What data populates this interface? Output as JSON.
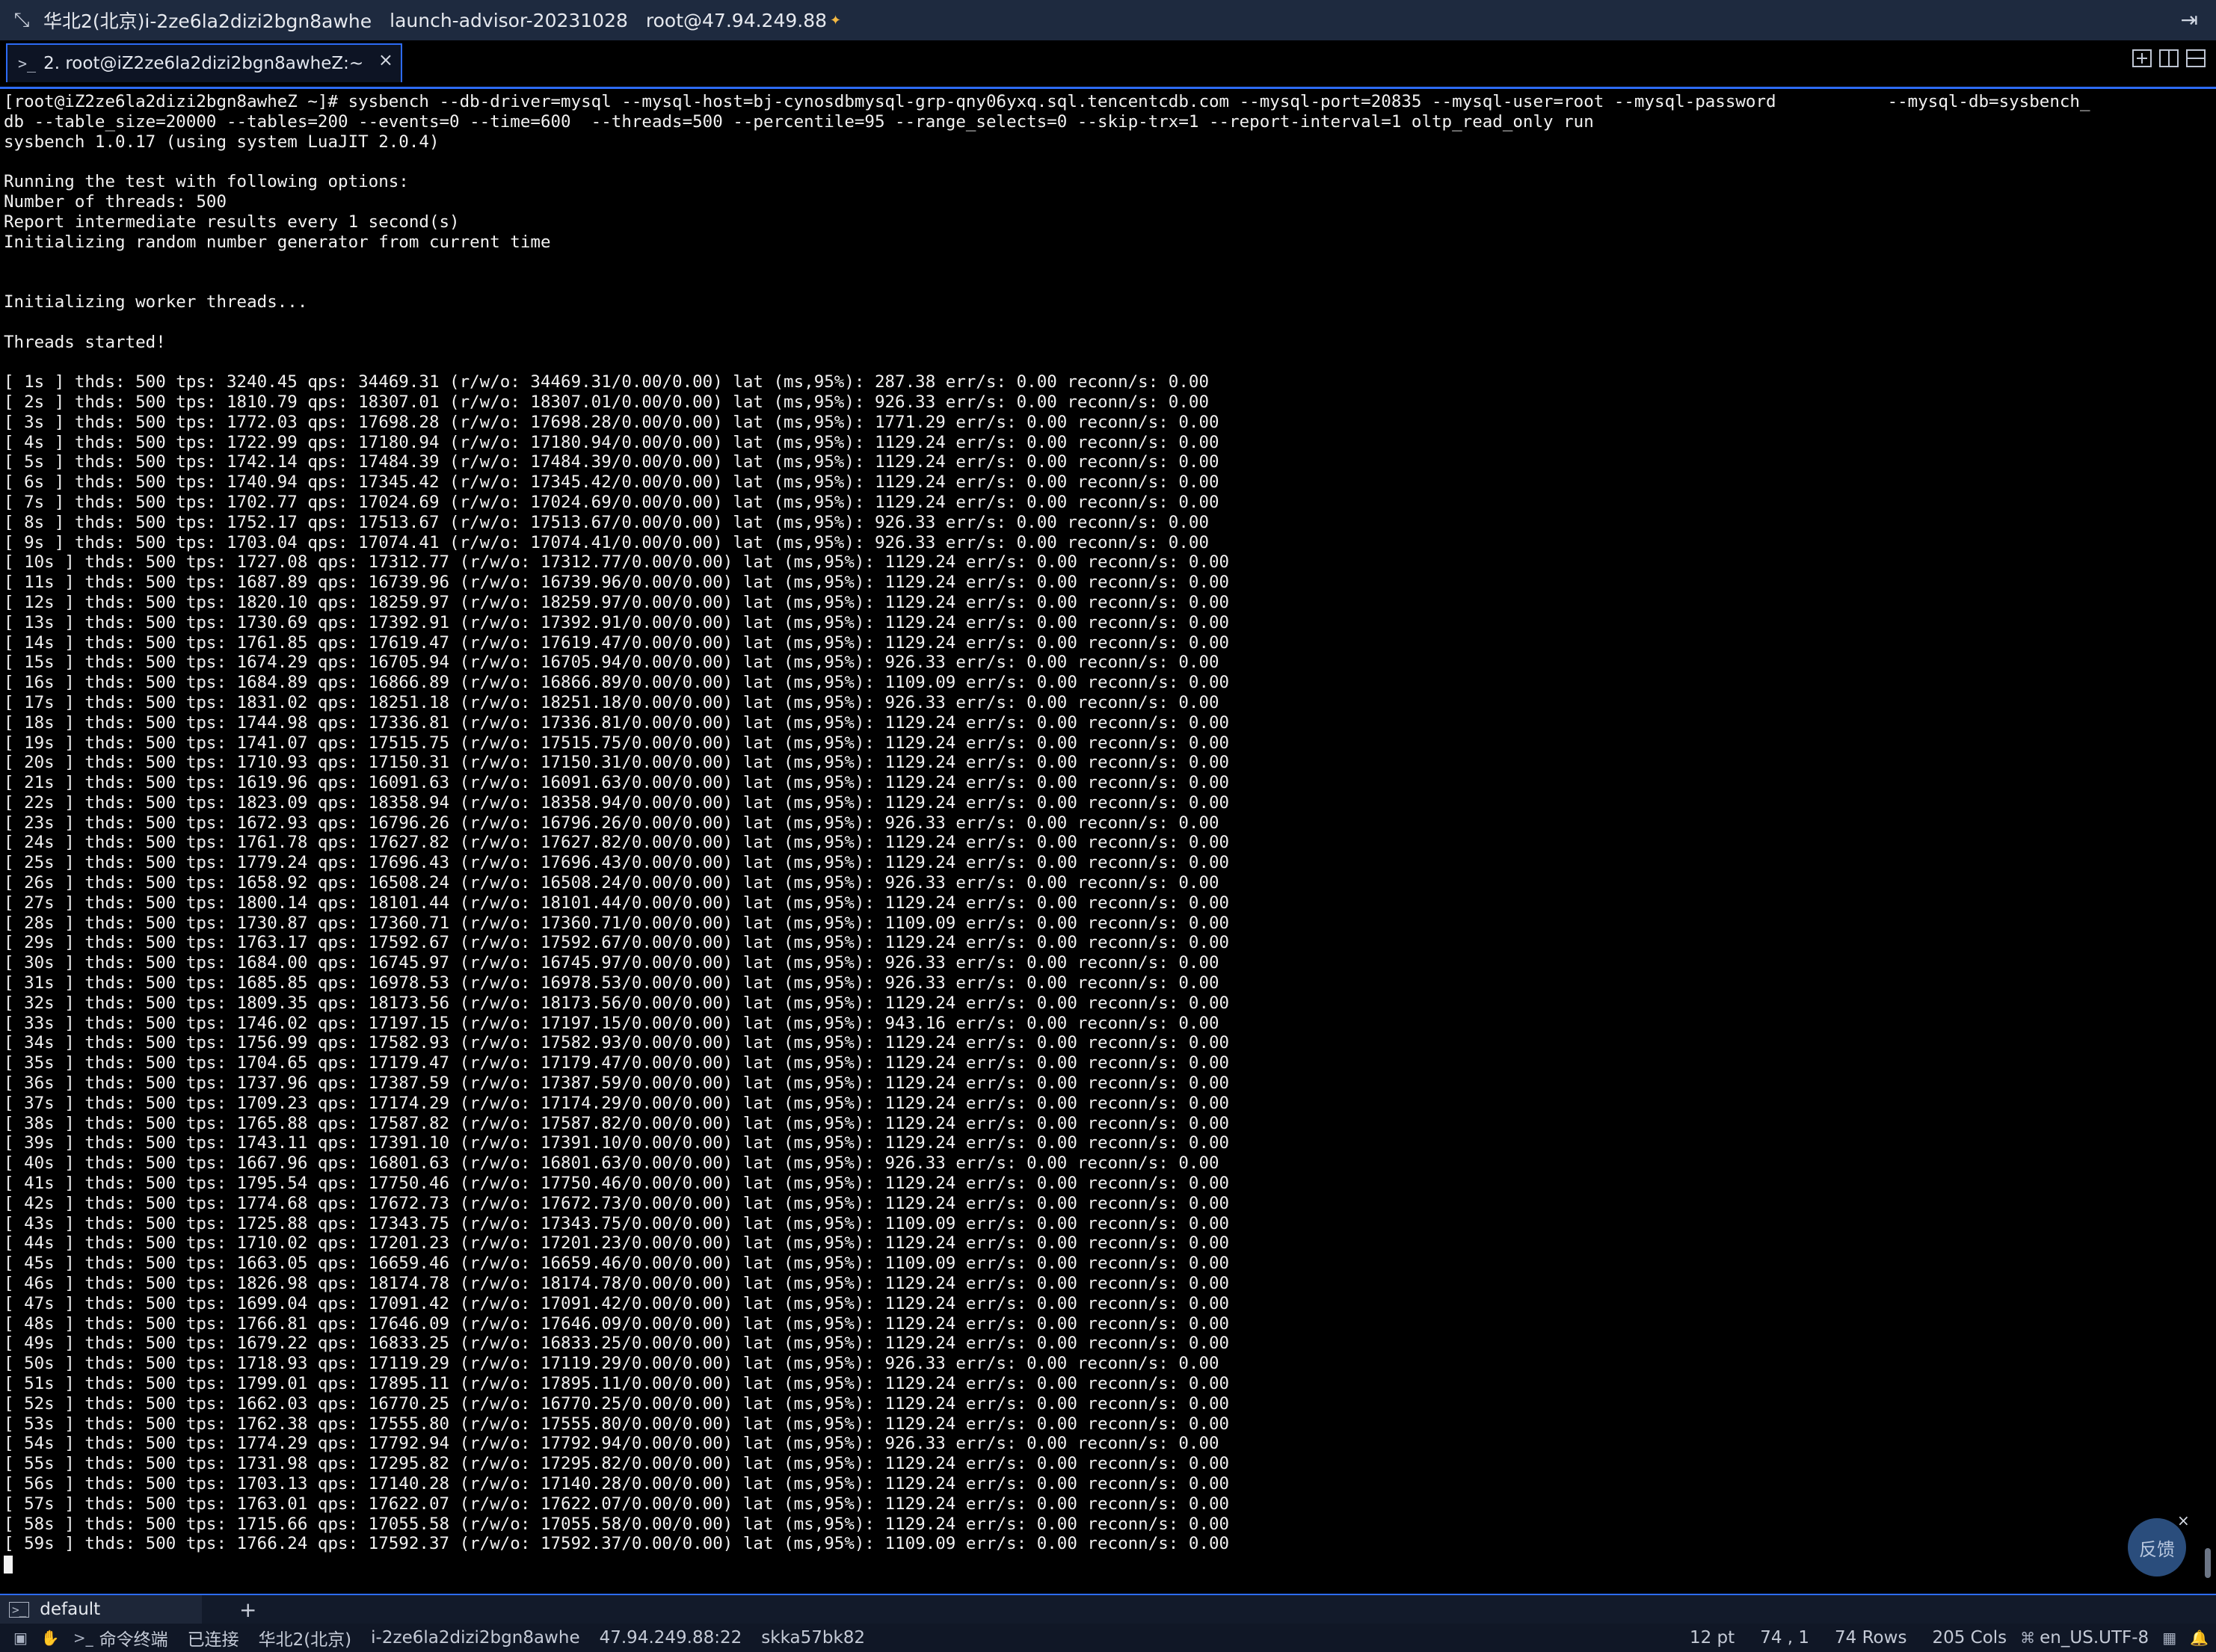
{
  "titlebar": {
    "region_host": "华北2(北京)i-2ze6la2dizi2bgn8awhe",
    "project": "launch-advisor-20231028",
    "user_host": "root@47.94.249.88"
  },
  "tab": {
    "label": "2. root@iZ2ze6la2dizi2bgn8awheZ:~",
    "close_glyph": "×"
  },
  "terminal": {
    "lines": [
      "[root@iZ2ze6la2dizi2bgn8awheZ ~]# sysbench --db-driver=mysql --mysql-host=bj-cynosdbmysql-grp-qny06yxq.sql.tencentcdb.com --mysql-port=20835 --mysql-user=root --mysql-password           --mysql-db=sysbench_",
      "db --table_size=20000 --tables=200 --events=0 --time=600  --threads=500 --percentile=95 --range_selects=0 --skip-trx=1 --report-interval=1 oltp_read_only run",
      "sysbench 1.0.17 (using system LuaJIT 2.0.4)",
      "",
      "Running the test with following options:",
      "Number of threads: 500",
      "Report intermediate results every 1 second(s)",
      "Initializing random number generator from current time",
      "",
      "",
      "Initializing worker threads...",
      "",
      "Threads started!",
      "",
      "[ 1s ] thds: 500 tps: 3240.45 qps: 34469.31 (r/w/o: 34469.31/0.00/0.00) lat (ms,95%): 287.38 err/s: 0.00 reconn/s: 0.00",
      "[ 2s ] thds: 500 tps: 1810.79 qps: 18307.01 (r/w/o: 18307.01/0.00/0.00) lat (ms,95%): 926.33 err/s: 0.00 reconn/s: 0.00",
      "[ 3s ] thds: 500 tps: 1772.03 qps: 17698.28 (r/w/o: 17698.28/0.00/0.00) lat (ms,95%): 1771.29 err/s: 0.00 reconn/s: 0.00",
      "[ 4s ] thds: 500 tps: 1722.99 qps: 17180.94 (r/w/o: 17180.94/0.00/0.00) lat (ms,95%): 1129.24 err/s: 0.00 reconn/s: 0.00",
      "[ 5s ] thds: 500 tps: 1742.14 qps: 17484.39 (r/w/o: 17484.39/0.00/0.00) lat (ms,95%): 1129.24 err/s: 0.00 reconn/s: 0.00",
      "[ 6s ] thds: 500 tps: 1740.94 qps: 17345.42 (r/w/o: 17345.42/0.00/0.00) lat (ms,95%): 1129.24 err/s: 0.00 reconn/s: 0.00",
      "[ 7s ] thds: 500 tps: 1702.77 qps: 17024.69 (r/w/o: 17024.69/0.00/0.00) lat (ms,95%): 1129.24 err/s: 0.00 reconn/s: 0.00",
      "[ 8s ] thds: 500 tps: 1752.17 qps: 17513.67 (r/w/o: 17513.67/0.00/0.00) lat (ms,95%): 926.33 err/s: 0.00 reconn/s: 0.00",
      "[ 9s ] thds: 500 tps: 1703.04 qps: 17074.41 (r/w/o: 17074.41/0.00/0.00) lat (ms,95%): 926.33 err/s: 0.00 reconn/s: 0.00",
      "[ 10s ] thds: 500 tps: 1727.08 qps: 17312.77 (r/w/o: 17312.77/0.00/0.00) lat (ms,95%): 1129.24 err/s: 0.00 reconn/s: 0.00",
      "[ 11s ] thds: 500 tps: 1687.89 qps: 16739.96 (r/w/o: 16739.96/0.00/0.00) lat (ms,95%): 1129.24 err/s: 0.00 reconn/s: 0.00",
      "[ 12s ] thds: 500 tps: 1820.10 qps: 18259.97 (r/w/o: 18259.97/0.00/0.00) lat (ms,95%): 1129.24 err/s: 0.00 reconn/s: 0.00",
      "[ 13s ] thds: 500 tps: 1730.69 qps: 17392.91 (r/w/o: 17392.91/0.00/0.00) lat (ms,95%): 1129.24 err/s: 0.00 reconn/s: 0.00",
      "[ 14s ] thds: 500 tps: 1761.85 qps: 17619.47 (r/w/o: 17619.47/0.00/0.00) lat (ms,95%): 1129.24 err/s: 0.00 reconn/s: 0.00",
      "[ 15s ] thds: 500 tps: 1674.29 qps: 16705.94 (r/w/o: 16705.94/0.00/0.00) lat (ms,95%): 926.33 err/s: 0.00 reconn/s: 0.00",
      "[ 16s ] thds: 500 tps: 1684.89 qps: 16866.89 (r/w/o: 16866.89/0.00/0.00) lat (ms,95%): 1109.09 err/s: 0.00 reconn/s: 0.00",
      "[ 17s ] thds: 500 tps: 1831.02 qps: 18251.18 (r/w/o: 18251.18/0.00/0.00) lat (ms,95%): 926.33 err/s: 0.00 reconn/s: 0.00",
      "[ 18s ] thds: 500 tps: 1744.98 qps: 17336.81 (r/w/o: 17336.81/0.00/0.00) lat (ms,95%): 1129.24 err/s: 0.00 reconn/s: 0.00",
      "[ 19s ] thds: 500 tps: 1741.07 qps: 17515.75 (r/w/o: 17515.75/0.00/0.00) lat (ms,95%): 1129.24 err/s: 0.00 reconn/s: 0.00",
      "[ 20s ] thds: 500 tps: 1710.93 qps: 17150.31 (r/w/o: 17150.31/0.00/0.00) lat (ms,95%): 1129.24 err/s: 0.00 reconn/s: 0.00",
      "[ 21s ] thds: 500 tps: 1619.96 qps: 16091.63 (r/w/o: 16091.63/0.00/0.00) lat (ms,95%): 1129.24 err/s: 0.00 reconn/s: 0.00",
      "[ 22s ] thds: 500 tps: 1823.09 qps: 18358.94 (r/w/o: 18358.94/0.00/0.00) lat (ms,95%): 1129.24 err/s: 0.00 reconn/s: 0.00",
      "[ 23s ] thds: 500 tps: 1672.93 qps: 16796.26 (r/w/o: 16796.26/0.00/0.00) lat (ms,95%): 926.33 err/s: 0.00 reconn/s: 0.00",
      "[ 24s ] thds: 500 tps: 1761.78 qps: 17627.82 (r/w/o: 17627.82/0.00/0.00) lat (ms,95%): 1129.24 err/s: 0.00 reconn/s: 0.00",
      "[ 25s ] thds: 500 tps: 1779.24 qps: 17696.43 (r/w/o: 17696.43/0.00/0.00) lat (ms,95%): 1129.24 err/s: 0.00 reconn/s: 0.00",
      "[ 26s ] thds: 500 tps: 1658.92 qps: 16508.24 (r/w/o: 16508.24/0.00/0.00) lat (ms,95%): 926.33 err/s: 0.00 reconn/s: 0.00",
      "[ 27s ] thds: 500 tps: 1800.14 qps: 18101.44 (r/w/o: 18101.44/0.00/0.00) lat (ms,95%): 1129.24 err/s: 0.00 reconn/s: 0.00",
      "[ 28s ] thds: 500 tps: 1730.87 qps: 17360.71 (r/w/o: 17360.71/0.00/0.00) lat (ms,95%): 1109.09 err/s: 0.00 reconn/s: 0.00",
      "[ 29s ] thds: 500 tps: 1763.17 qps: 17592.67 (r/w/o: 17592.67/0.00/0.00) lat (ms,95%): 1129.24 err/s: 0.00 reconn/s: 0.00",
      "[ 30s ] thds: 500 tps: 1684.00 qps: 16745.97 (r/w/o: 16745.97/0.00/0.00) lat (ms,95%): 926.33 err/s: 0.00 reconn/s: 0.00",
      "[ 31s ] thds: 500 tps: 1685.85 qps: 16978.53 (r/w/o: 16978.53/0.00/0.00) lat (ms,95%): 926.33 err/s: 0.00 reconn/s: 0.00",
      "[ 32s ] thds: 500 tps: 1809.35 qps: 18173.56 (r/w/o: 18173.56/0.00/0.00) lat (ms,95%): 1129.24 err/s: 0.00 reconn/s: 0.00",
      "[ 33s ] thds: 500 tps: 1746.02 qps: 17197.15 (r/w/o: 17197.15/0.00/0.00) lat (ms,95%): 943.16 err/s: 0.00 reconn/s: 0.00",
      "[ 34s ] thds: 500 tps: 1756.99 qps: 17582.93 (r/w/o: 17582.93/0.00/0.00) lat (ms,95%): 1129.24 err/s: 0.00 reconn/s: 0.00",
      "[ 35s ] thds: 500 tps: 1704.65 qps: 17179.47 (r/w/o: 17179.47/0.00/0.00) lat (ms,95%): 1129.24 err/s: 0.00 reconn/s: 0.00",
      "[ 36s ] thds: 500 tps: 1737.96 qps: 17387.59 (r/w/o: 17387.59/0.00/0.00) lat (ms,95%): 1129.24 err/s: 0.00 reconn/s: 0.00",
      "[ 37s ] thds: 500 tps: 1709.23 qps: 17174.29 (r/w/o: 17174.29/0.00/0.00) lat (ms,95%): 1129.24 err/s: 0.00 reconn/s: 0.00",
      "[ 38s ] thds: 500 tps: 1765.88 qps: 17587.82 (r/w/o: 17587.82/0.00/0.00) lat (ms,95%): 1129.24 err/s: 0.00 reconn/s: 0.00",
      "[ 39s ] thds: 500 tps: 1743.11 qps: 17391.10 (r/w/o: 17391.10/0.00/0.00) lat (ms,95%): 1129.24 err/s: 0.00 reconn/s: 0.00",
      "[ 40s ] thds: 500 tps: 1667.96 qps: 16801.63 (r/w/o: 16801.63/0.00/0.00) lat (ms,95%): 926.33 err/s: 0.00 reconn/s: 0.00",
      "[ 41s ] thds: 500 tps: 1795.54 qps: 17750.46 (r/w/o: 17750.46/0.00/0.00) lat (ms,95%): 1129.24 err/s: 0.00 reconn/s: 0.00",
      "[ 42s ] thds: 500 tps: 1774.68 qps: 17672.73 (r/w/o: 17672.73/0.00/0.00) lat (ms,95%): 1129.24 err/s: 0.00 reconn/s: 0.00",
      "[ 43s ] thds: 500 tps: 1725.88 qps: 17343.75 (r/w/o: 17343.75/0.00/0.00) lat (ms,95%): 1109.09 err/s: 0.00 reconn/s: 0.00",
      "[ 44s ] thds: 500 tps: 1710.02 qps: 17201.23 (r/w/o: 17201.23/0.00/0.00) lat (ms,95%): 1129.24 err/s: 0.00 reconn/s: 0.00",
      "[ 45s ] thds: 500 tps: 1663.05 qps: 16659.46 (r/w/o: 16659.46/0.00/0.00) lat (ms,95%): 1109.09 err/s: 0.00 reconn/s: 0.00",
      "[ 46s ] thds: 500 tps: 1826.98 qps: 18174.78 (r/w/o: 18174.78/0.00/0.00) lat (ms,95%): 1129.24 err/s: 0.00 reconn/s: 0.00",
      "[ 47s ] thds: 500 tps: 1699.04 qps: 17091.42 (r/w/o: 17091.42/0.00/0.00) lat (ms,95%): 1129.24 err/s: 0.00 reconn/s: 0.00",
      "[ 48s ] thds: 500 tps: 1766.81 qps: 17646.09 (r/w/o: 17646.09/0.00/0.00) lat (ms,95%): 1129.24 err/s: 0.00 reconn/s: 0.00",
      "[ 49s ] thds: 500 tps: 1679.22 qps: 16833.25 (r/w/o: 16833.25/0.00/0.00) lat (ms,95%): 1129.24 err/s: 0.00 reconn/s: 0.00",
      "[ 50s ] thds: 500 tps: 1718.93 qps: 17119.29 (r/w/o: 17119.29/0.00/0.00) lat (ms,95%): 926.33 err/s: 0.00 reconn/s: 0.00",
      "[ 51s ] thds: 500 tps: 1799.01 qps: 17895.11 (r/w/o: 17895.11/0.00/0.00) lat (ms,95%): 1129.24 err/s: 0.00 reconn/s: 0.00",
      "[ 52s ] thds: 500 tps: 1662.03 qps: 16770.25 (r/w/o: 16770.25/0.00/0.00) lat (ms,95%): 1129.24 err/s: 0.00 reconn/s: 0.00",
      "[ 53s ] thds: 500 tps: 1762.38 qps: 17555.80 (r/w/o: 17555.80/0.00/0.00) lat (ms,95%): 1129.24 err/s: 0.00 reconn/s: 0.00",
      "[ 54s ] thds: 500 tps: 1774.29 qps: 17792.94 (r/w/o: 17792.94/0.00/0.00) lat (ms,95%): 926.33 err/s: 0.00 reconn/s: 0.00",
      "[ 55s ] thds: 500 tps: 1731.98 qps: 17295.82 (r/w/o: 17295.82/0.00/0.00) lat (ms,95%): 1129.24 err/s: 0.00 reconn/s: 0.00",
      "[ 56s ] thds: 500 tps: 1703.13 qps: 17140.28 (r/w/o: 17140.28/0.00/0.00) lat (ms,95%): 1129.24 err/s: 0.00 reconn/s: 0.00",
      "[ 57s ] thds: 500 tps: 1763.01 qps: 17622.07 (r/w/o: 17622.07/0.00/0.00) lat (ms,95%): 1129.24 err/s: 0.00 reconn/s: 0.00",
      "[ 58s ] thds: 500 tps: 1715.66 qps: 17055.58 (r/w/o: 17055.58/0.00/0.00) lat (ms,95%): 1129.24 err/s: 0.00 reconn/s: 0.00",
      "[ 59s ] thds: 500 tps: 1766.24 qps: 17592.37 (r/w/o: 17592.37/0.00/0.00) lat (ms,95%): 1109.09 err/s: 0.00 reconn/s: 0.00"
    ]
  },
  "feedback": {
    "label": "反馈",
    "close_glyph": "×"
  },
  "sessionbar": {
    "session_name": "default",
    "add_glyph": "+"
  },
  "statusbar": {
    "terminal_type": "命令终端",
    "connection": "已连接",
    "region": "华北2(北京)",
    "instance": "i-2ze6la2dizi2bgn8awhe",
    "address": "47.94.249.88:22",
    "key": "skka57bk82",
    "font_size": "12 pt",
    "cursor_pos": "74 , 1",
    "rows": "74 Rows",
    "cols": "205 Cols",
    "encoding": "en_US.UTF-8"
  },
  "colors": {
    "titlebar_bg": "#1e2a3f",
    "accent": "#2d6bf5",
    "terminal_bg": "#000000",
    "terminal_fg": "#f2f2f2"
  }
}
